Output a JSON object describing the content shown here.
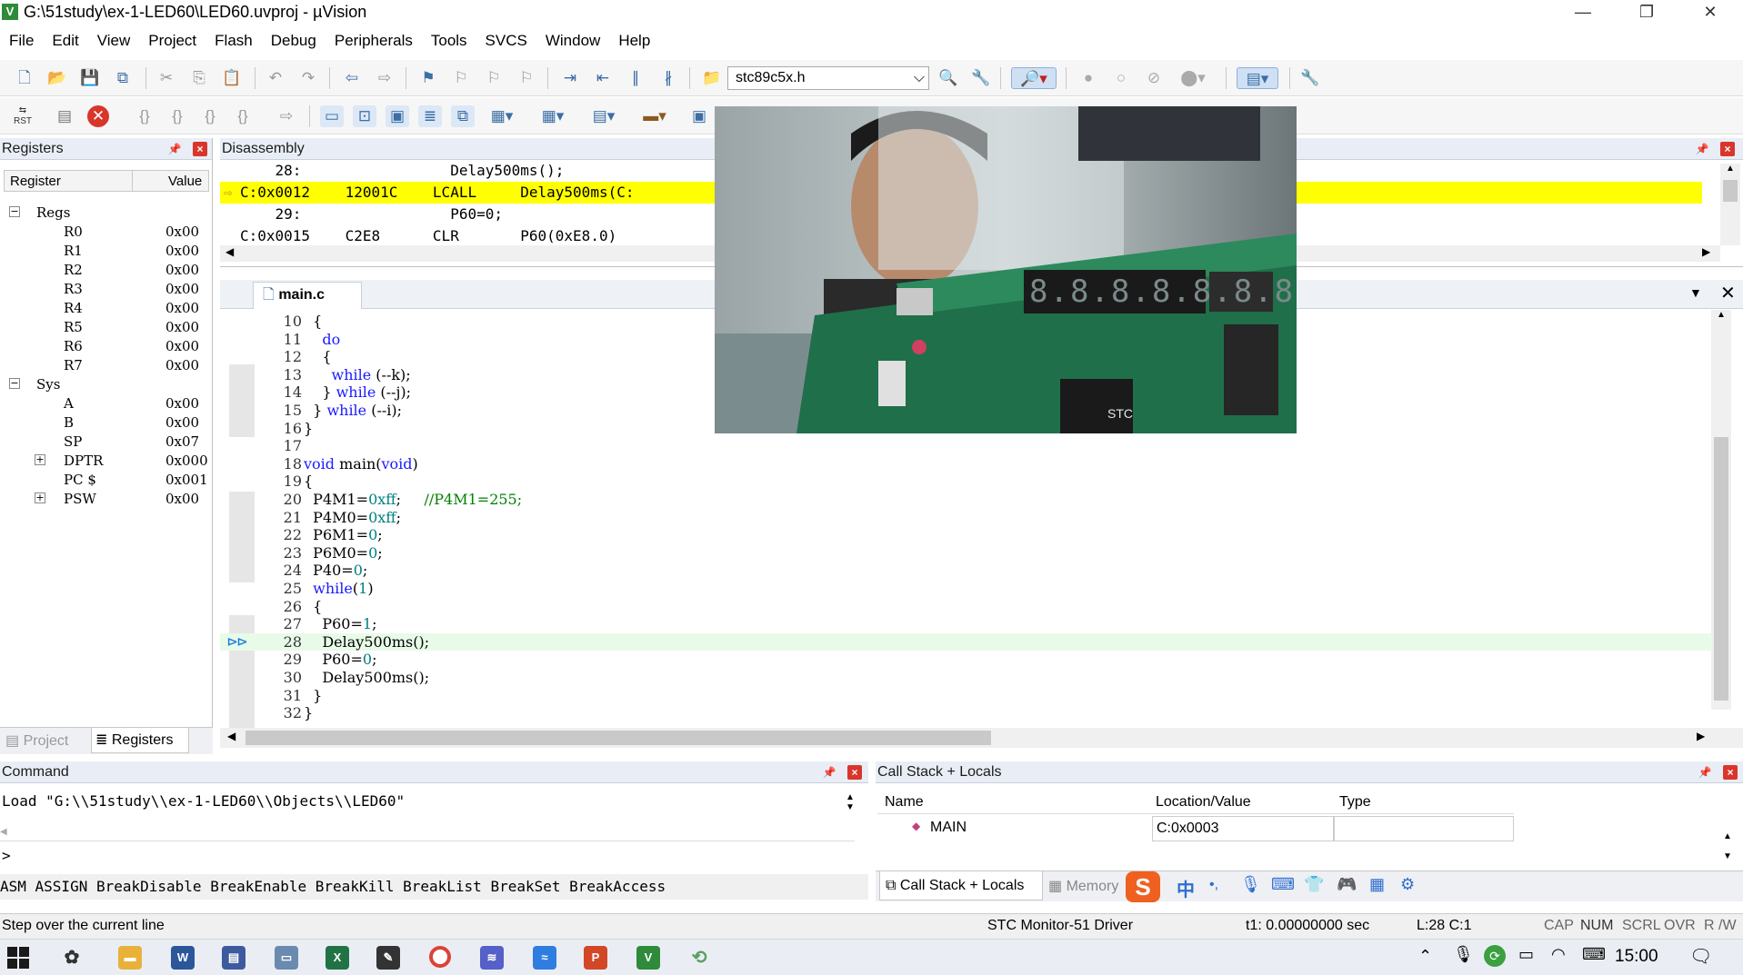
{
  "window": {
    "title": "G:\\51study\\ex-1-LED60\\LED60.uvproj - µVision",
    "app_icon": "uvision-icon",
    "minimize_glyph": "—",
    "restore_glyph": "❐",
    "close_glyph": "✕"
  },
  "menu": [
    "File",
    "Edit",
    "View",
    "Project",
    "Flash",
    "Debug",
    "Peripherals",
    "Tools",
    "SVCS",
    "Window",
    "Help"
  ],
  "toolbar1": {
    "header_combo_value": "stc89c5x.h"
  },
  "toolbar2": {
    "rst_label": "RST"
  },
  "registers": {
    "title": "Registers",
    "col_register": "Register",
    "col_value": "Value",
    "groups": [
      {
        "name": "Regs",
        "rows": [
          {
            "name": "R0",
            "value": "0x00"
          },
          {
            "name": "R1",
            "value": "0x00"
          },
          {
            "name": "R2",
            "value": "0x00"
          },
          {
            "name": "R3",
            "value": "0x00"
          },
          {
            "name": "R4",
            "value": "0x00"
          },
          {
            "name": "R5",
            "value": "0x00"
          },
          {
            "name": "R6",
            "value": "0x00"
          },
          {
            "name": "R7",
            "value": "0x00"
          }
        ]
      },
      {
        "name": "Sys",
        "rows": [
          {
            "name": "A",
            "value": "0x00"
          },
          {
            "name": "B",
            "value": "0x00"
          },
          {
            "name": "SP",
            "value": "0x07"
          },
          {
            "name": "DPTR",
            "value": "0x000"
          },
          {
            "name": "PC $",
            "value": "0x001"
          },
          {
            "name": "PSW",
            "value": "0x00"
          }
        ]
      }
    ],
    "tab_project": "Project",
    "tab_registers": "Registers"
  },
  "disassembly": {
    "title": "Disassembly",
    "lines": [
      {
        "text": "    28:                 Delay500ms();",
        "current": false
      },
      {
        "text": "C:0x0012    12001C    LCALL     Delay500ms(C:",
        "current": true
      },
      {
        "text": "    29:                 P60=0;",
        "current": false
      },
      {
        "text": "C:0x0015    C2E8      CLR       P60(0xE8.0)",
        "current": false
      }
    ]
  },
  "editor": {
    "tab": "main.c",
    "current_line": 28,
    "lines": [
      {
        "n": "10",
        "code": "  {"
      },
      {
        "n": "11",
        "code": "    do"
      },
      {
        "n": "12",
        "code": "    {"
      },
      {
        "n": "13",
        "code": "      while (--k);"
      },
      {
        "n": "14",
        "code": "    } while (--j);"
      },
      {
        "n": "15",
        "code": "  } while (--i);"
      },
      {
        "n": "16",
        "code": "}"
      },
      {
        "n": "17",
        "code": ""
      },
      {
        "n": "18",
        "code": "void main(void)"
      },
      {
        "n": "19",
        "code": "{"
      },
      {
        "n": "20",
        "code": "  P4M1=0xff;     //P4M1=255;"
      },
      {
        "n": "21",
        "code": "  P4M0=0xff;"
      },
      {
        "n": "22",
        "code": "  P6M1=0;"
      },
      {
        "n": "23",
        "code": "  P6M0=0;"
      },
      {
        "n": "24",
        "code": "  P40=0;"
      },
      {
        "n": "25",
        "code": "  while(1)"
      },
      {
        "n": "26",
        "code": "  {"
      },
      {
        "n": "27",
        "code": "    P60=1;"
      },
      {
        "n": "28",
        "code": "    Delay500ms();"
      },
      {
        "n": "29",
        "code": "    P60=0;"
      },
      {
        "n": "30",
        "code": "    Delay500ms();"
      },
      {
        "n": "31",
        "code": "  }"
      },
      {
        "n": "32",
        "code": "}"
      }
    ]
  },
  "command": {
    "title": "Command",
    "output": "Load \"G:\\\\51study\\\\ex-1-LED60\\\\Objects\\\\LED60\"",
    "prompt": ">",
    "hints": "ASM ASSIGN BreakDisable BreakEnable BreakKill BreakList BreakSet BreakAccess"
  },
  "callstack": {
    "title": "Call Stack + Locals",
    "col_name": "Name",
    "col_location": "Location/Value",
    "col_type": "Type",
    "rows": [
      {
        "name": "MAIN",
        "location": "C:0x0003",
        "type": ""
      }
    ],
    "tab_callstack": "Call Stack + Locals",
    "tab_memory": "Memory"
  },
  "ime": {
    "logo": "S",
    "mode": "中"
  },
  "status": {
    "message": "Step over the current line",
    "driver": "STC Monitor-51 Driver",
    "time": "t1: 0.00000000 sec",
    "position": "L:28 C:1",
    "flags": [
      "CAP",
      "NUM",
      "SCRL",
      "OVR",
      "R /W"
    ]
  },
  "taskbar": {
    "clock": "15:00"
  },
  "video": {
    "display_digits": "8.8.8.8.8.8.8.8.",
    "board_label": "STC"
  }
}
